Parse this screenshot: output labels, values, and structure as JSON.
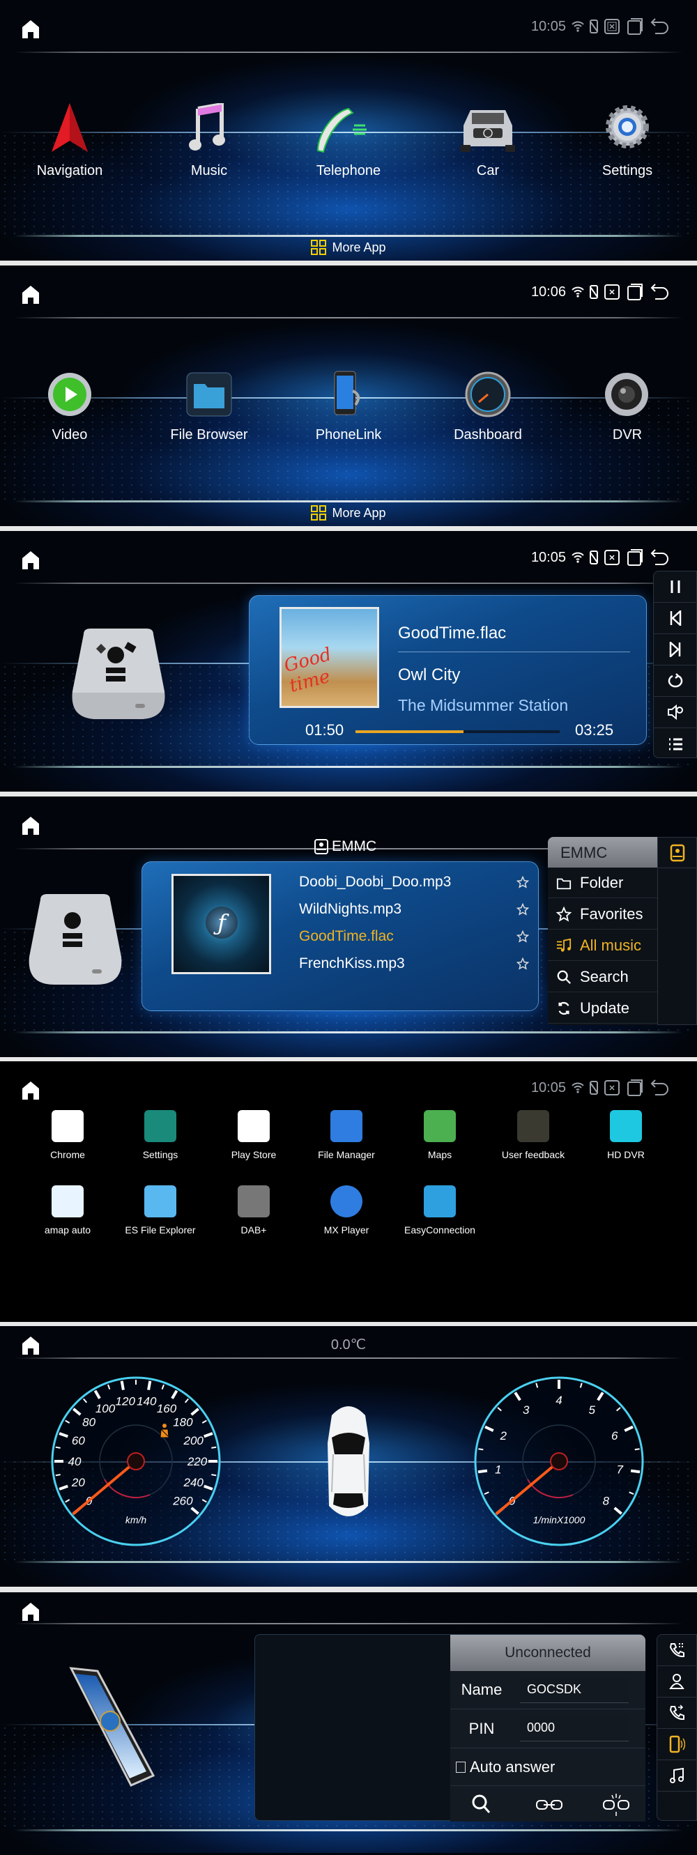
{
  "status_bar": {
    "time_1": "10:05",
    "time_2": "10:06"
  },
  "home_screen_1": {
    "apps": [
      {
        "label": "Navigation",
        "icon": "navigation-arrow-icon"
      },
      {
        "label": "Music",
        "icon": "music-note-icon"
      },
      {
        "label": "Telephone",
        "icon": "telephone-handset-icon"
      },
      {
        "label": "Car",
        "icon": "car-icon"
      },
      {
        "label": "Settings",
        "icon": "gear-icon"
      }
    ],
    "more_app": "More App"
  },
  "home_screen_2": {
    "apps": [
      {
        "label": "Video",
        "icon": "play-icon"
      },
      {
        "label": "File Browser",
        "icon": "folder-icon"
      },
      {
        "label": "PhoneLink",
        "icon": "phone-link-icon"
      },
      {
        "label": "Dashboard",
        "icon": "gauge-icon"
      },
      {
        "label": "DVR",
        "icon": "camera-lens-icon"
      }
    ],
    "more_app": "More App"
  },
  "now_playing": {
    "title": "GoodTime.flac",
    "artist": "Owl City",
    "album": "The Midsummer Station",
    "elapsed": "01:50",
    "duration": "03:25",
    "progress_fraction": 0.53,
    "progress_color": "#e8a623",
    "album_art_text": "Good time"
  },
  "music_list": {
    "source": "EMMC",
    "tracks": [
      {
        "name": "Doobi_Doobi_Doo.mp3",
        "active": false
      },
      {
        "name": "WildNights.mp3",
        "active": false
      },
      {
        "name": "GoodTime.flac",
        "active": true
      },
      {
        "name": "FrenchKiss.mp3",
        "active": false
      }
    ],
    "menu_header": "EMMC",
    "menu": [
      {
        "label": "Folder",
        "icon": "folder-icon",
        "active": false
      },
      {
        "label": "Favorites",
        "icon": "star-icon",
        "active": false
      },
      {
        "label": "All music",
        "icon": "music-list-icon",
        "active": true
      },
      {
        "label": "Search",
        "icon": "search-icon",
        "active": false
      },
      {
        "label": "Update",
        "icon": "refresh-icon",
        "active": false
      }
    ],
    "accent": "#f0b323"
  },
  "app_drawer": {
    "apps": [
      {
        "label": "Chrome",
        "color": "#ffffff"
      },
      {
        "label": "Settings",
        "color": "#1a8a7a"
      },
      {
        "label": "Play Store",
        "color": "#ffffff"
      },
      {
        "label": "File Manager",
        "color": "#2f7de0"
      },
      {
        "label": "Maps",
        "color": "#4caf50"
      },
      {
        "label": "User feedback",
        "color": "#3a3a30"
      },
      {
        "label": "HD DVR",
        "color": "#1ec8e0"
      },
      {
        "label": "amap auto",
        "color": "#e8f4ff"
      },
      {
        "label": "ES File Explorer",
        "color": "#5ab8f0"
      },
      {
        "label": "DAB+",
        "color": "#777777"
      },
      {
        "label": "MX Player",
        "color": "#2f7de0"
      },
      {
        "label": "EasyConnection",
        "color": "#2ea0e0"
      }
    ]
  },
  "dashboard": {
    "temperature": "0.0℃",
    "speed_unit": "km/h",
    "speed_labels": [
      "0",
      "20",
      "40",
      "60",
      "80",
      "100",
      "120",
      "140",
      "160",
      "180",
      "200",
      "220",
      "240",
      "260"
    ],
    "speed_value": 0,
    "rpm_unit": "1/minX1000",
    "rpm_labels": [
      "0",
      "1",
      "2",
      "3",
      "4",
      "5",
      "6",
      "7",
      "8"
    ],
    "rpm_value": 0,
    "seatbelt_icon_color": "#f08a1a"
  },
  "bluetooth": {
    "status": "Unconnected",
    "name_label": "Name",
    "name_value": "GOCSDK",
    "pin_label": "PIN",
    "pin_value": "0000",
    "auto_answer_label": "Auto answer",
    "auto_answer_checked": false
  }
}
